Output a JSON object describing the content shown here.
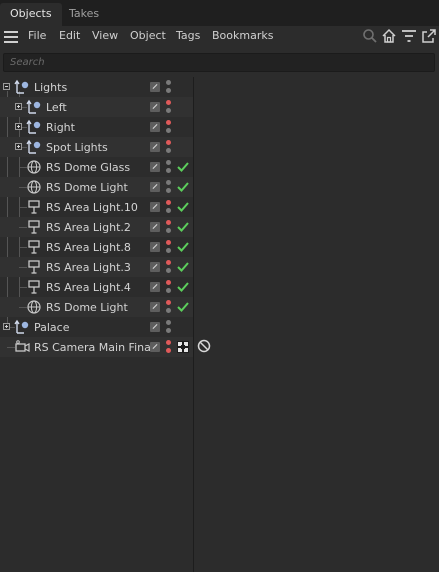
{
  "tabs": [
    {
      "label": "Objects",
      "active": true
    },
    {
      "label": "Takes",
      "active": false
    }
  ],
  "menu": {
    "items": [
      "File",
      "Edit",
      "View",
      "Object",
      "Tags",
      "Bookmarks"
    ]
  },
  "search": {
    "placeholder": "Search"
  },
  "colors": {
    "dot_red": "#e05a5a",
    "dot_gray": "#7a7a7a",
    "check_green": "#5ccf5c",
    "icon_blue": "#9db6e0"
  },
  "tree": {
    "rows": [
      {
        "label": "Lights",
        "icon": "null-object-icon",
        "expander": "minus",
        "dot_top": "gray",
        "dot_bot": "gray",
        "check": false
      },
      {
        "label": "Left",
        "icon": "null-object-icon",
        "expander": "plus",
        "dot_top": "red",
        "dot_bot": "gray",
        "check": false
      },
      {
        "label": "Right",
        "icon": "null-object-icon",
        "expander": "plus",
        "dot_top": "red",
        "dot_bot": "gray",
        "check": false
      },
      {
        "label": "Spot Lights",
        "icon": "null-object-icon",
        "expander": "plus",
        "dot_top": "red",
        "dot_bot": "gray",
        "check": false
      },
      {
        "label": "RS Dome Glass",
        "icon": "dome-light-icon",
        "expander": "",
        "dot_top": "gray",
        "dot_bot": "gray",
        "check": true
      },
      {
        "label": "RS Dome Light",
        "icon": "dome-light-icon",
        "expander": "",
        "dot_top": "gray",
        "dot_bot": "gray",
        "check": true
      },
      {
        "label": "RS Area Light.10",
        "icon": "area-light-icon",
        "expander": "",
        "dot_top": "red",
        "dot_bot": "gray",
        "check": true
      },
      {
        "label": "RS Area Light.2",
        "icon": "area-light-icon",
        "expander": "",
        "dot_top": "red",
        "dot_bot": "gray",
        "check": true
      },
      {
        "label": "RS Area Light.8",
        "icon": "area-light-icon",
        "expander": "",
        "dot_top": "red",
        "dot_bot": "gray",
        "check": true
      },
      {
        "label": "RS Area Light.3",
        "icon": "area-light-icon",
        "expander": "",
        "dot_top": "red",
        "dot_bot": "gray",
        "check": true
      },
      {
        "label": "RS Area Light.4",
        "icon": "area-light-icon",
        "expander": "",
        "dot_top": "red",
        "dot_bot": "gray",
        "check": true
      },
      {
        "label": "RS Dome Light",
        "icon": "dome-light-icon",
        "expander": "",
        "dot_top": "red",
        "dot_bot": "gray",
        "check": true
      },
      {
        "label": "Palace",
        "icon": "null-object-icon",
        "expander": "plus",
        "dot_top": "gray",
        "dot_bot": "gray",
        "check": false
      },
      {
        "label": "RS Camera Main Final",
        "icon": "camera-icon",
        "expander": "",
        "dot_top": "red",
        "dot_bot": "red",
        "check": false
      }
    ]
  }
}
